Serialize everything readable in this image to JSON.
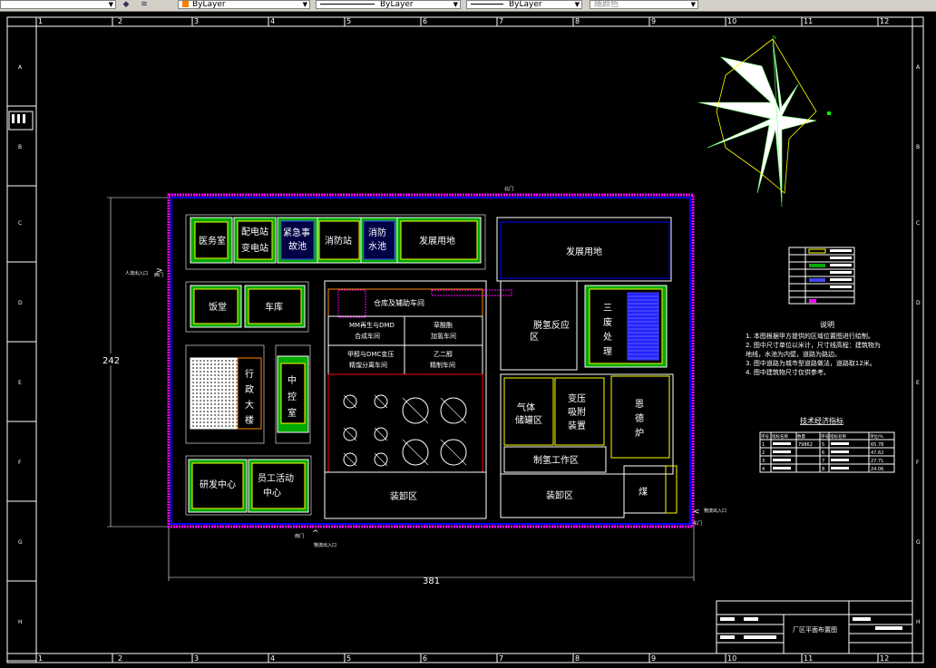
{
  "toolbar": {
    "combo_color": "ByLayer",
    "combo_linetype": "ByLayer",
    "combo_lineweight": "ByLayer",
    "combo_plotstyle": "随颜色"
  },
  "grid": {
    "columns": [
      "1",
      "2",
      "3",
      "4",
      "5",
      "6",
      "7",
      "8",
      "9",
      "10",
      "11",
      "12"
    ],
    "rows": [
      "A",
      "B",
      "C",
      "D",
      "E",
      "F",
      "G",
      "H"
    ]
  },
  "compass": {
    "north_label": "N"
  },
  "dimensions": {
    "height": "242",
    "width": "381"
  },
  "buildings": {
    "clinic": "医务室",
    "power1": "配电站",
    "power2": "变电站",
    "emergency1": "紧急事",
    "emergency2": "故池",
    "fire_station": "消防站",
    "fire_pool1": "消防",
    "fire_pool2": "水池",
    "dev_land_left": "发展用地",
    "dev_land_right": "发展用地",
    "canteen": "饭堂",
    "garage": "车库",
    "admin": [
      "行",
      "政",
      "大",
      "楼"
    ],
    "control": [
      "中",
      "控",
      "室"
    ],
    "rnd": "研发中心",
    "staff1": "员工活动",
    "staff2": "中心",
    "warehouse": "仓库及辅助车间",
    "mm1": "MM再生与DMD",
    "mm2": "合成车间",
    "oxalic1": "草酸酯",
    "oxalic2": "加氢车间",
    "methanol1": "甲醇与DMC变压",
    "methanol2": "精馏分离车间",
    "glycol1": "乙二醇",
    "glycol2": "精制车间",
    "loading_left": "装卸区",
    "loading_right": "装卸区",
    "decarb1": "脱氢反应",
    "decarb2": "区",
    "waste": [
      "三",
      "废",
      "处",
      "理"
    ],
    "gas1": "气体",
    "gas2": "储罐区",
    "psa1": "变压",
    "psa2": "吸附",
    "psa3": "装置",
    "boiler": [
      "恩",
      "德",
      "炉"
    ],
    "hydrogen": "制氢工作区",
    "coal": "煤"
  },
  "notes": {
    "title": "说明",
    "lines": [
      "1. 本图根据甲方提供的区域位置图进行绘制。",
      "2. 图中尺寸单位以米计，尺寸线高程：建筑物为",
      "   地线，水池为内壁，道路为路边。",
      "3. 图中道路为城市型道路做法，道路取12米。",
      "4. 图中建筑物尺寸仅供参考。"
    ]
  },
  "econ": {
    "title": "技术经济指标",
    "headers": [
      "序号",
      "指标名称",
      "数量",
      "序号",
      "指标名称",
      "单位/%"
    ],
    "rows": [
      [
        "1",
        "",
        "79862",
        "5",
        "",
        "65.78"
      ],
      [
        "2",
        "",
        "",
        "6",
        "",
        "47.62"
      ],
      [
        "3",
        "",
        "",
        "7",
        "",
        "27.71"
      ],
      [
        "4",
        "",
        "",
        "8",
        "",
        "24.06"
      ]
    ]
  },
  "title_block": {
    "drawing_name": "厂区平面布置图"
  },
  "entrances": {
    "left": "人流出入口",
    "bottom": "物流出入口",
    "right": "物流出入口"
  },
  "small_labels": {
    "north_gate": "北门",
    "east_gate": "东门",
    "west_gate": "西门",
    "south_gate": "南门"
  }
}
